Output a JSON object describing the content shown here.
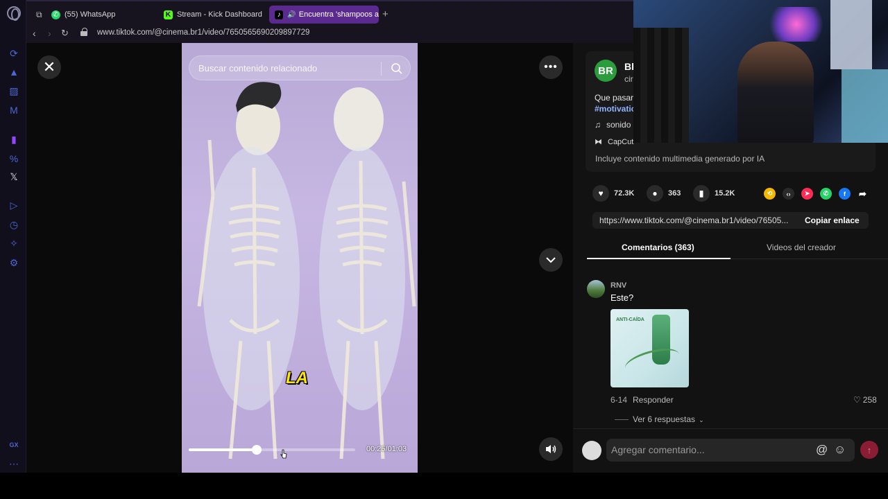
{
  "browser": {
    "tabs": [
      {
        "label": "(55) WhatsApp"
      },
      {
        "label": "Stream - Kick Dashboard"
      },
      {
        "label": "Encuentra 'shampoos a"
      }
    ],
    "url": "www.tiktok.com/@cinema.br1/video/7650565690209897729"
  },
  "video": {
    "search_placeholder": "Buscar contenido relacionado",
    "caption": "LA",
    "time": "00:25/01:03",
    "progress": 0.41
  },
  "post": {
    "avatar_text": "BR",
    "author": "Bl",
    "handle": "cir",
    "description": "Que pasar",
    "hashtag": "#motivatio",
    "music": "sonido",
    "capcut": "CapCut",
    "ai_note": "Incluye contenido multimedia generado por IA",
    "likes": "72.3K",
    "comments": "363",
    "saves": "15.2K",
    "link": "https://www.tiktok.com/@cinema.br1/video/76505...",
    "copy_label": "Copiar enlace"
  },
  "panel_tabs": {
    "comments": "Comentarios (363)",
    "creator": "Videos del creador"
  },
  "comment": {
    "user": "RNV",
    "text": "Este?",
    "image_label": "ANTI-CAÍDA",
    "date": "6-14",
    "reply": "Responder",
    "likes": "258",
    "view_replies": "Ver 6 respuestas"
  },
  "composer": {
    "placeholder": "Agregar comentario..."
  },
  "sidebar": {
    "gx_label": "GX"
  },
  "colors": {
    "accent": "#fe2c55",
    "active_tab": "#5b2a8f",
    "hashtag": "#8fb3ff"
  }
}
